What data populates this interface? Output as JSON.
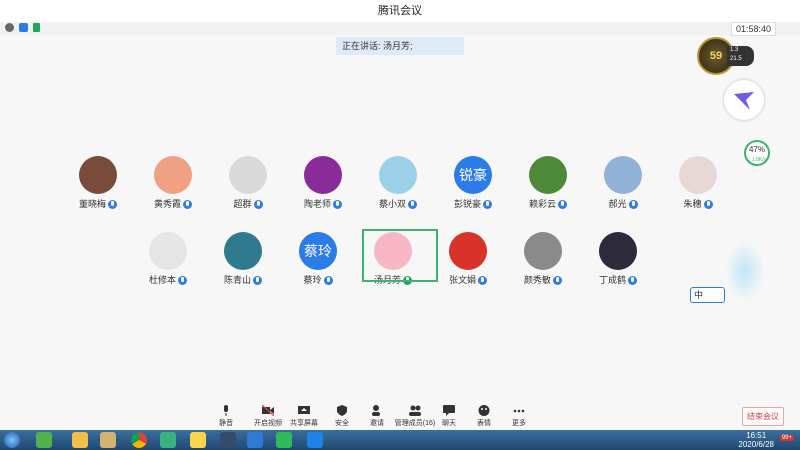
{
  "window": {
    "title": "腾讯会议",
    "timer": "01:58:40"
  },
  "speaking": {
    "label": "正在讲话: 汤月芳;"
  },
  "participants_row1": [
    {
      "name": "董晓梅",
      "color": "#7a4b3a"
    },
    {
      "name": "黄秀霞",
      "color": "#f0a083"
    },
    {
      "name": "超群",
      "color": "#d9d9d9"
    },
    {
      "name": "陶老师",
      "color": "#8a2b9a"
    },
    {
      "name": "蔡小双",
      "color": "#9ad0e8"
    },
    {
      "name": "彭锐豪",
      "avatar_text": "锐豪",
      "color": "#2b7ce9"
    },
    {
      "name": "赖彩云",
      "color": "#4c8a3a"
    },
    {
      "name": "郝光",
      "color": "#8fb2d6"
    },
    {
      "name": "朱穗",
      "color": "#e8d7d7"
    }
  ],
  "participants_row2": [
    {
      "name": "杜修本",
      "color": "#e5e5e5"
    },
    {
      "name": "陈青山",
      "color": "#2f7a8c"
    },
    {
      "name": "蔡玲",
      "avatar_text": "蔡玲",
      "color": "#2b7ce9"
    },
    {
      "name": "汤月芳",
      "color": "#f7b7c4"
    },
    {
      "name": "张文娟",
      "color": "#d8322a"
    },
    {
      "name": "颜秀敏",
      "color": "#8a8a8a"
    },
    {
      "name": "丁成鹤",
      "color": "#2d2a3a"
    }
  ],
  "widgets": {
    "level": "59",
    "speed_up": "1.3",
    "speed_down": "21.5",
    "cpu_percent": "47%",
    "net_rate": "↑ 1.8K/s",
    "ime": "中"
  },
  "toolbar": {
    "mute": "静音",
    "video": "开启视频",
    "share": "共享屏幕",
    "security": "安全",
    "invite": "邀请",
    "members": "管理成员(16)",
    "chat": "聊天",
    "reactions": "表情",
    "more": "更多",
    "end": "结束会议"
  },
  "taskbar": {
    "time": "16:51",
    "date": "2020/6/28",
    "badge": "99+"
  }
}
